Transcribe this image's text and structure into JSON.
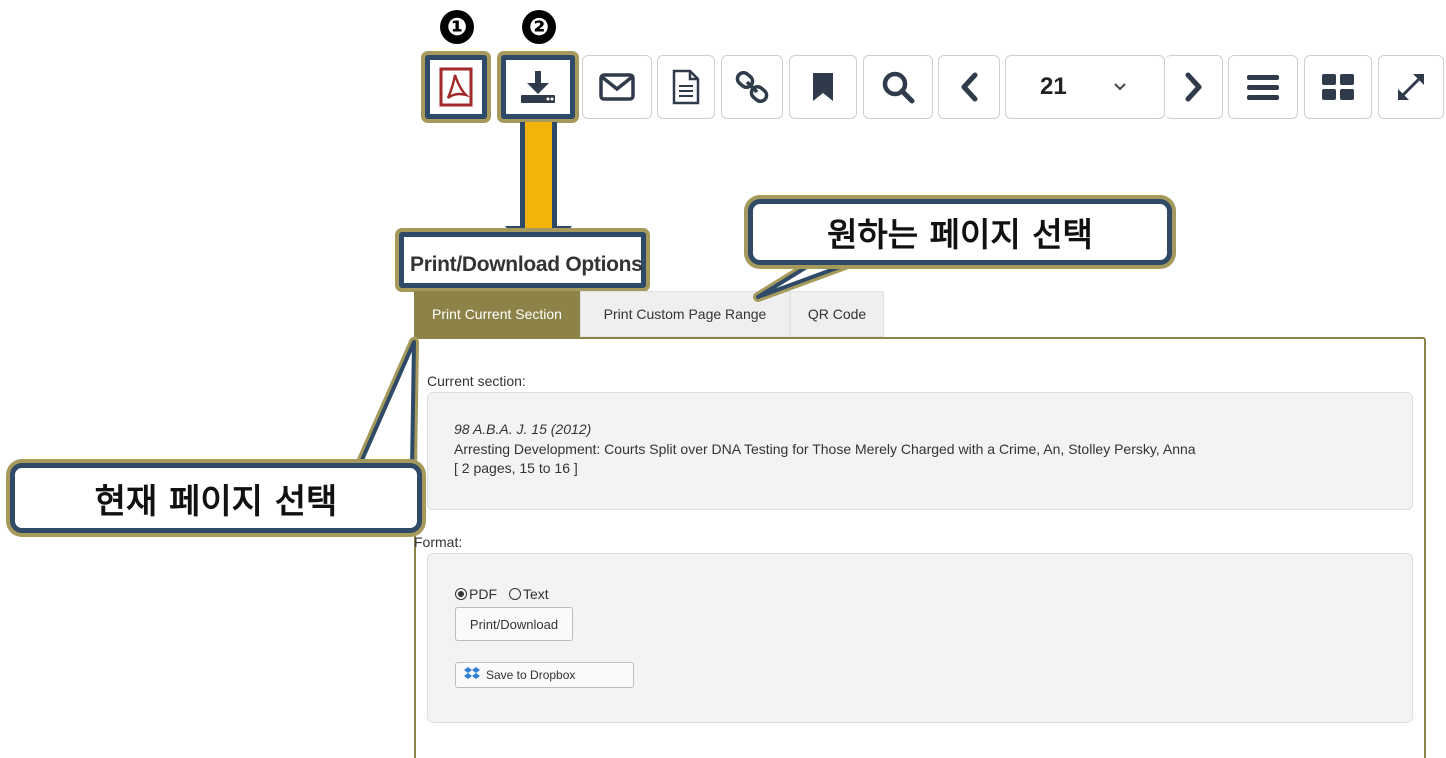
{
  "steps": [
    "❶",
    "❷"
  ],
  "toolbar": {
    "buttons": [
      "pdf-icon",
      "download-icon",
      "envelope-icon",
      "document-icon",
      "link-icon",
      "bookmark-icon",
      "search-icon",
      "chevron-left-icon",
      "page-selector",
      "chevron-right-icon",
      "menu-icon",
      "grid-icon",
      "expand-icon"
    ],
    "page_number": "21",
    "accent_pdf": "#a3282b"
  },
  "options": {
    "title": "Print/Download Options",
    "tabs": [
      "Print Current Section",
      "Print Custom Page Range",
      "QR Code"
    ],
    "current_section_label": "Current section:",
    "citation": "98 A.B.A. J. 15 (2012)",
    "article": "Arresting Development: Courts Split over DNA Testing for Those Merely Charged with a Crime, An, Stolley Persky, Anna",
    "pages": "[ 2 pages, 15 to 16 ]",
    "format_label": "Format:",
    "format_options": [
      "PDF",
      "Text"
    ],
    "format_selected": "PDF",
    "print_button": "Print/Download",
    "dropbox_button": "Save to Dropbox"
  },
  "callouts": {
    "custom_range": "원하는 페이지 선택",
    "current_page": "현재 페이지 선택"
  },
  "colors": {
    "highlight_border": "#2e4a66",
    "highlight_outer": "#a59a5c",
    "tab_active": "#8d8248",
    "arrow": "#f2b40a"
  }
}
